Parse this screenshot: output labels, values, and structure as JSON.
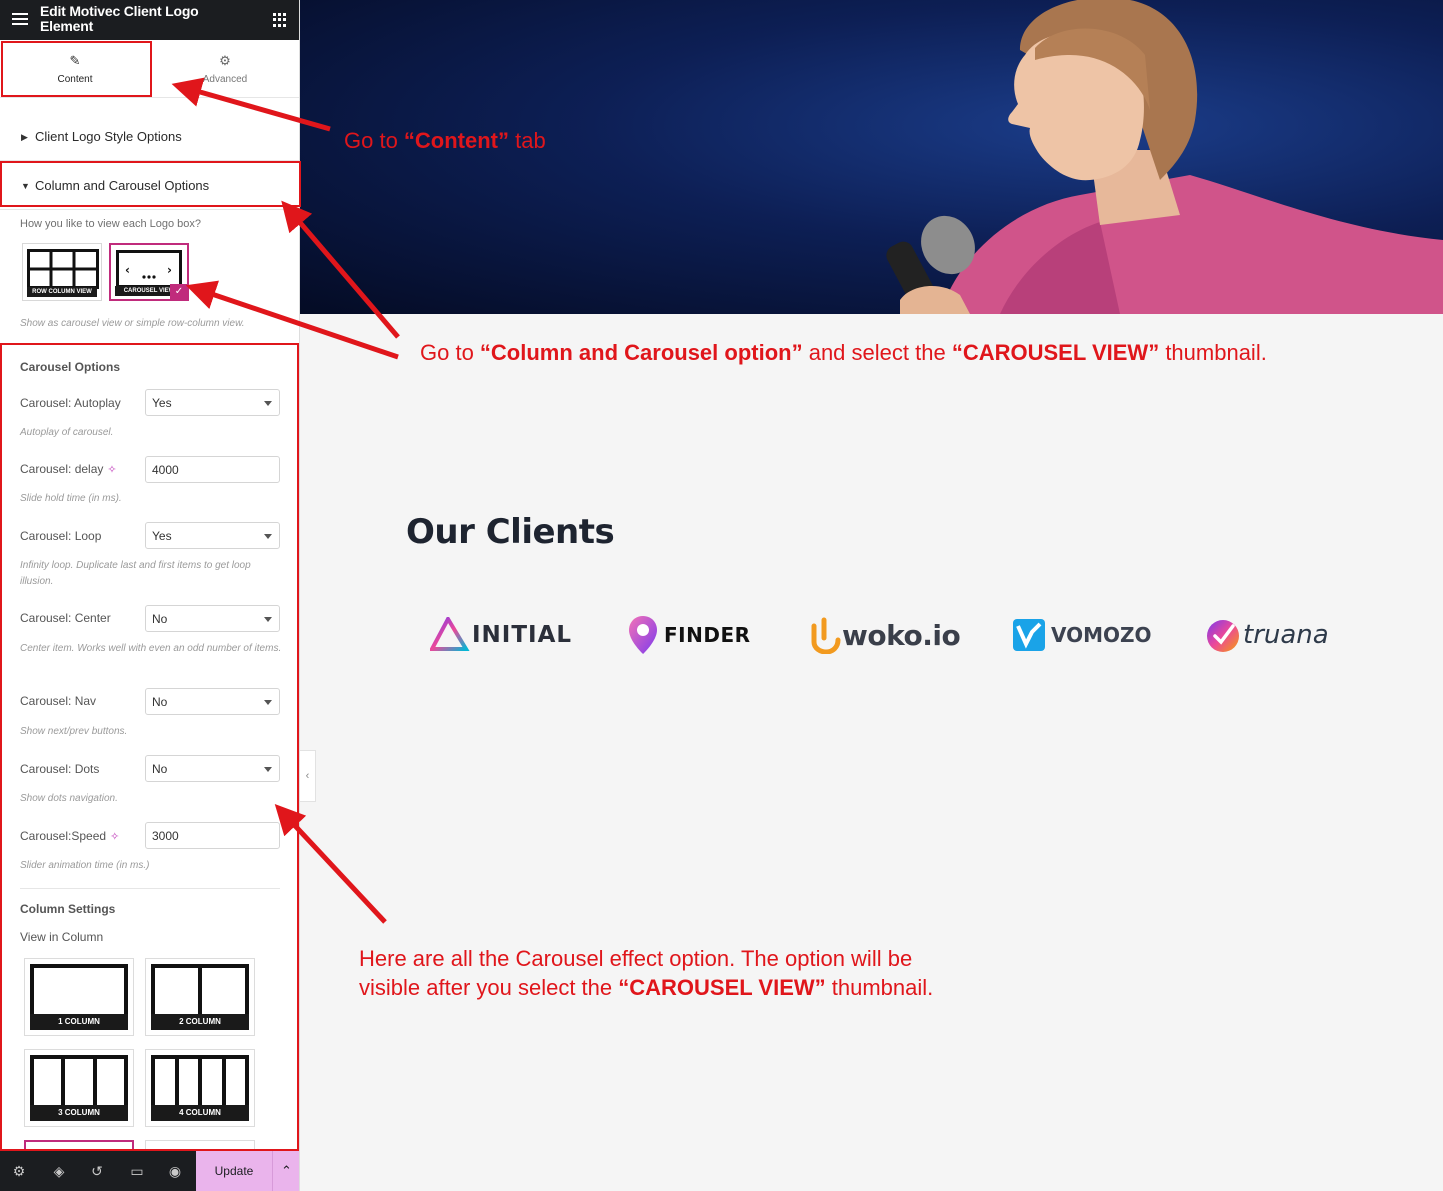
{
  "editor": {
    "title": "Edit Motivec Client Logo Element",
    "tabs": [
      {
        "label": "Content",
        "icon": "pencil-icon"
      },
      {
        "label": "Advanced",
        "icon": "gear-icon"
      }
    ],
    "sections": {
      "style_options": "Client Logo Style Options",
      "column_carousel": "Column and Carousel Options"
    },
    "view_question": "How you like to view each Logo box?",
    "view_thumbs": [
      {
        "caption": "ROW COLUMN VIEW",
        "selected": false
      },
      {
        "caption": "CAROUSEL VIEW",
        "selected": true
      }
    ],
    "view_hint": "Show as carousel view or simple row-column view.",
    "carousel_options_heading": "Carousel Options",
    "fields": [
      {
        "label": "Carousel: Autoplay",
        "value": "Yes",
        "kind": "select",
        "hint": "Autoplay of carousel.",
        "ai": false
      },
      {
        "label": "Carousel: delay",
        "value": "4000",
        "kind": "input",
        "hint": "Slide hold time (in ms).",
        "ai": true
      },
      {
        "label": "Carousel: Loop",
        "value": "Yes",
        "kind": "select",
        "hint": "Infinity loop. Duplicate last and first items to get loop illusion.",
        "ai": false
      },
      {
        "label": "Carousel: Center",
        "value": "No",
        "kind": "select",
        "hint": "Center item. Works well with even an odd number of items.",
        "ai": false
      },
      {
        "label": "Carousel: Nav",
        "value": "No",
        "kind": "select",
        "hint": "Show next/prev buttons.",
        "ai": false
      },
      {
        "label": "Carousel: Dots",
        "value": "No",
        "kind": "select",
        "hint": "Show dots navigation.",
        "ai": false
      },
      {
        "label": "Carousel:Speed",
        "value": "3000",
        "kind": "input",
        "hint": "Slider animation time (in ms.)",
        "ai": true
      }
    ],
    "column_settings_heading": "Column Settings",
    "view_in_column": "View in Column",
    "column_thumbs": [
      "1 COLUMN",
      "2 COLUMN",
      "3 COLUMN",
      "4 COLUMN"
    ],
    "bottom_bar": {
      "icons": [
        "settings-icon",
        "layers-icon",
        "history-icon",
        "responsive-icon",
        "preview-eye-icon"
      ],
      "update_label": "Update"
    }
  },
  "page": {
    "clients_title": "Our Clients",
    "logos": [
      {
        "name": "INITIAL",
        "color": "#2b2f3a"
      },
      {
        "name": "FINDER",
        "color": "#111111"
      },
      {
        "name": "woko.io",
        "color": "#3a3f4a",
        "accent": "#f29a1f"
      },
      {
        "name": "VOMOZO",
        "color": "#3c4250",
        "accent": "#1aa3e8"
      },
      {
        "name": "truana",
        "color": "#2e3a4a",
        "accent": "#e8345a"
      }
    ]
  },
  "annotations": {
    "a1_pre": "Go  to ",
    "a1_bold": "“Content”",
    "a1_post": " tab",
    "a2_pre": "Go to ",
    "a2_bold1": "“Column and Carousel option”",
    "a2_mid": " and select the ",
    "a2_bold2": "“CAROUSEL VIEW”",
    "a2_post": " thumbnail.",
    "a3_line1": "Here are all the Carousel effect option. The option will be",
    "a3_pre": "visible after you select the ",
    "a3_bold": "“CAROUSEL VIEW”",
    "a3_post": " thumbnail.",
    "color": "#e0161b"
  }
}
